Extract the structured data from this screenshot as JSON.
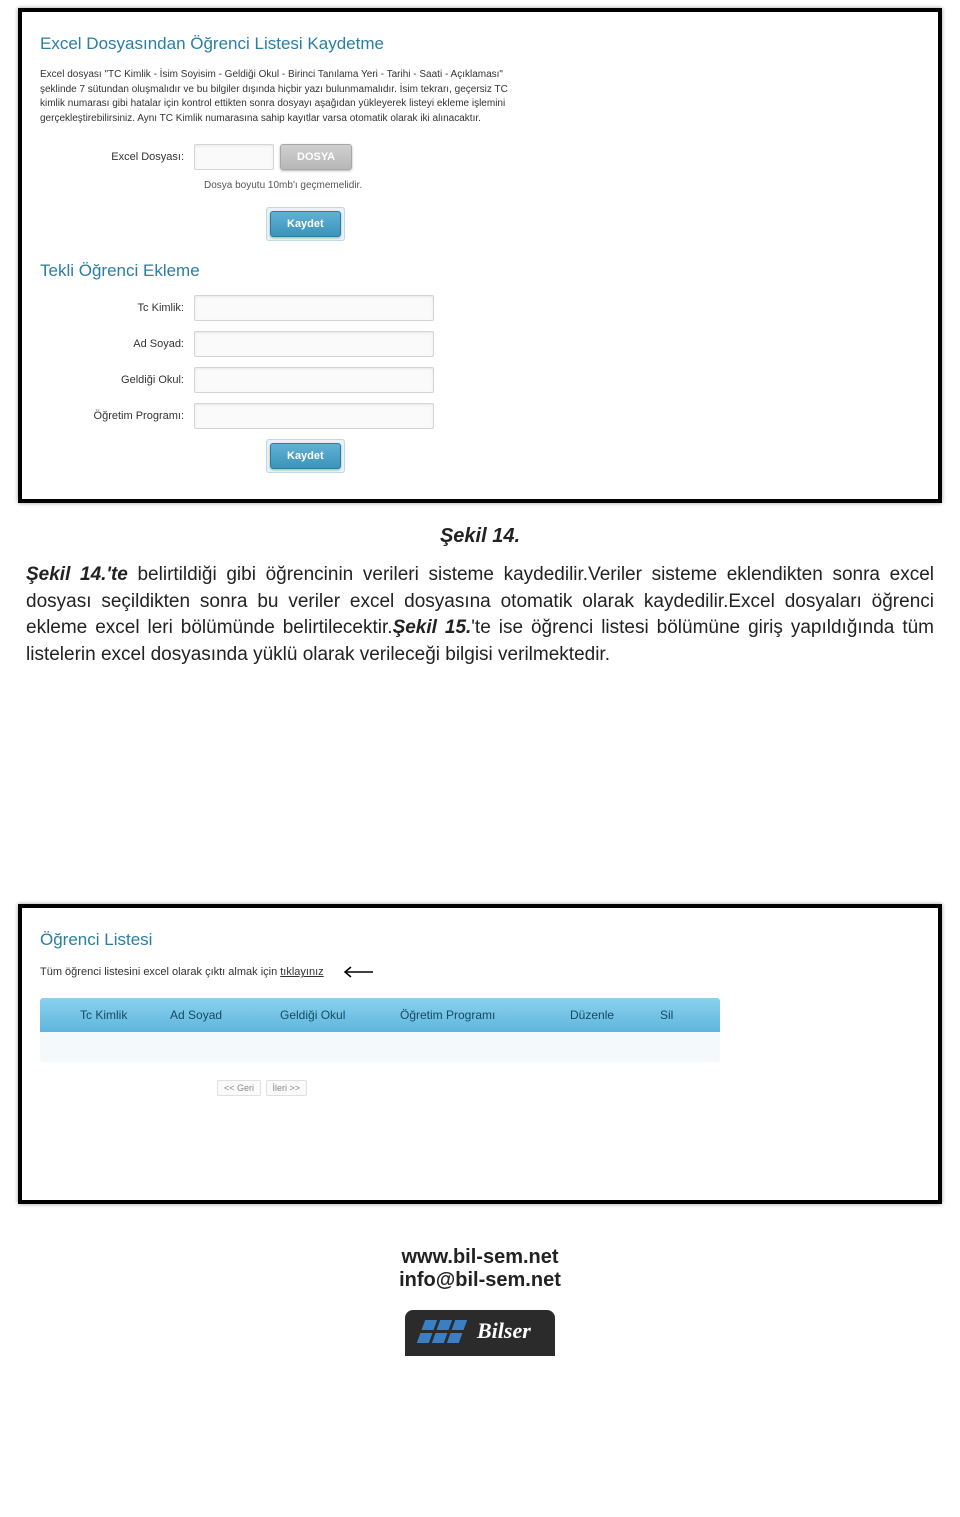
{
  "upload": {
    "title": "Excel Dosyasından Öğrenci Listesi Kaydetme",
    "description": "Excel dosyası \"TC Kimlik - İsim Soyisim - Geldiği Okul - Birinci Tanılama Yeri - Tarihi - Saati - Açıklaması\" şeklinde 7 sütundan oluşmalıdır ve bu bilgiler dışında hiçbir yazı bulunmamalıdır. İsim tekrarı, geçersiz TC kimlik numarası gibi hatalar için kontrol ettikten sonra dosyayı aşağıdan yükleyerek listeyi ekleme işlemini gerçekleştirebilirsiniz. Aynı TC Kimlik numarasına sahip kayıtlar varsa otomatik olarak iki alınacaktır.",
    "file_label": "Excel Dosyası:",
    "file_button": "DOSYA",
    "file_note": "Dosya boyutu 10mb'ı geçmemelidir.",
    "save": "Kaydet"
  },
  "single": {
    "title": "Tekli Öğrenci Ekleme",
    "fields": {
      "tc": "Tc Kimlik:",
      "name": "Ad Soyad:",
      "school": "Geldiği Okul:",
      "program": "Öğretim Programı:"
    },
    "save": "Kaydet"
  },
  "caption1": "Şekil 14.",
  "body": {
    "runs": [
      {
        "t": "Şekil 14.'te",
        "style": "bold-it"
      },
      {
        "t": "  belirtildiği gibi öğrencinin verileri sisteme kaydedilir.Veriler sisteme eklendikten sonra excel dosyası seçildikten sonra bu veriler excel dosyasına otomatik olarak kaydedilir.Excel dosyaları öğrenci ekleme excel leri bölümünde belirtilecektir.",
        "style": ""
      },
      {
        "t": "Şekil 15.",
        "style": "bold-it"
      },
      {
        "t": "'te ise öğrenci listesi bölümüne giriş yapıldığında tüm listelerin excel dosyasında yüklü olarak verileceği bilgisi verilmektedir.",
        "style": ""
      }
    ]
  },
  "list": {
    "title": "Öğrenci Listesi",
    "subtitle_pre": "Tüm öğrenci listesini excel olarak çıktı almak için ",
    "subtitle_link": "tıklayınız",
    "columns": {
      "tc": "Tc Kimlik",
      "name": "Ad Soyad",
      "school": "Geldiği Okul",
      "program": "Öğretim Programı",
      "edit": "Düzenle",
      "del": "Sil"
    },
    "pager_prev": "<< Geri",
    "pager_next": "İleri >>"
  },
  "footer": {
    "url": "www.bil-sem.net",
    "email": "info@bil-sem.net",
    "logo_text": "Bilser"
  }
}
